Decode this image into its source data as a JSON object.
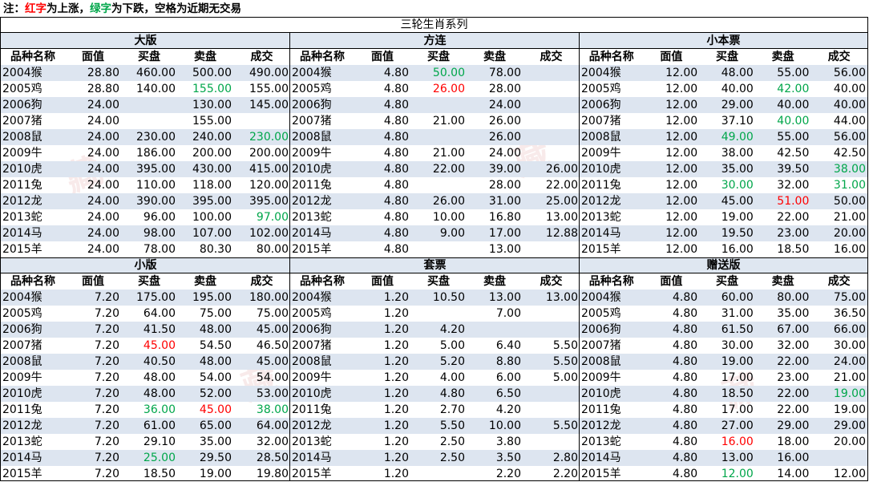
{
  "note": {
    "prefix": "注：",
    "red_word": "红字",
    "mid1": "为上涨，",
    "green_word": "绿字",
    "mid2": "为下跌，空格为近期无交易"
  },
  "colors": {
    "up": "#ff0000",
    "down": "#00a64a",
    "row_alt": "#dde5f0",
    "title_bg": "#dfe7f1"
  },
  "main_title": "三轮生肖系列",
  "headers": [
    "品种名称",
    "面值",
    "买盘",
    "卖盘",
    "成交"
  ],
  "watermark_chars": [
    "藏",
    "藏",
    "藏",
    "藏"
  ],
  "panels": [
    {
      "title": "大版",
      "rows": [
        {
          "name": "2004猴",
          "face": "28.80",
          "buy": "460.00",
          "sell": "500.00",
          "deal": "490.00",
          "sell_c": "",
          "buy_c": "",
          "deal_c": ""
        },
        {
          "name": "2005鸡",
          "face": "28.80",
          "buy": "140.00",
          "sell": "155.00",
          "deal": "155.00",
          "sell_c": "down"
        },
        {
          "name": "2006狗",
          "face": "24.00",
          "buy": "",
          "sell": "130.00",
          "deal": "145.00"
        },
        {
          "name": "2007猪",
          "face": "24.00",
          "buy": "",
          "sell": "155.00",
          "deal": ""
        },
        {
          "name": "2008鼠",
          "face": "24.00",
          "buy": "230.00",
          "sell": "240.00",
          "deal": "230.00",
          "deal_c": "down"
        },
        {
          "name": "2009牛",
          "face": "24.00",
          "buy": "186.00",
          "sell": "200.00",
          "deal": "200.00"
        },
        {
          "name": "2010虎",
          "face": "24.00",
          "buy": "395.00",
          "sell": "430.00",
          "deal": "415.00"
        },
        {
          "name": "2011兔",
          "face": "24.00",
          "buy": "110.00",
          "sell": "118.00",
          "deal": "120.00"
        },
        {
          "name": "2012龙",
          "face": "24.00",
          "buy": "390.00",
          "sell": "395.00",
          "deal": "395.00"
        },
        {
          "name": "2013蛇",
          "face": "24.00",
          "buy": "96.00",
          "sell": "100.00",
          "deal": "97.00",
          "deal_c": "down"
        },
        {
          "name": "2014马",
          "face": "24.00",
          "buy": "98.00",
          "sell": "107.00",
          "deal": "102.00"
        },
        {
          "name": "2015羊",
          "face": "24.00",
          "buy": "78.00",
          "sell": "80.30",
          "deal": "80.00"
        }
      ]
    },
    {
      "title": "方连",
      "rows": [
        {
          "name": "2004猴",
          "face": "4.80",
          "buy": "50.00",
          "sell": "78.00",
          "deal": "",
          "buy_c": "down"
        },
        {
          "name": "2005鸡",
          "face": "4.80",
          "buy": "26.00",
          "sell": "28.00",
          "deal": "",
          "buy_c": "up"
        },
        {
          "name": "2006狗",
          "face": "4.80",
          "buy": "",
          "sell": "24.00",
          "deal": ""
        },
        {
          "name": "2007猪",
          "face": "4.80",
          "buy": "21.00",
          "sell": "26.00",
          "deal": ""
        },
        {
          "name": "2008鼠",
          "face": "4.80",
          "buy": "",
          "sell": "26.00",
          "deal": ""
        },
        {
          "name": "2009牛",
          "face": "4.80",
          "buy": "21.00",
          "sell": "24.00",
          "deal": ""
        },
        {
          "name": "2010虎",
          "face": "4.80",
          "buy": "22.00",
          "sell": "39.00",
          "deal": "26.00"
        },
        {
          "name": "2011兔",
          "face": "4.80",
          "buy": "",
          "sell": "28.00",
          "deal": "22.00"
        },
        {
          "name": "2012龙",
          "face": "4.80",
          "buy": "26.00",
          "sell": "31.00",
          "deal": "25.00"
        },
        {
          "name": "2013蛇",
          "face": "4.80",
          "buy": "10.00",
          "sell": "16.80",
          "deal": "13.00"
        },
        {
          "name": "2014马",
          "face": "4.80",
          "buy": "9.00",
          "sell": "17.00",
          "deal": "12.88"
        },
        {
          "name": "2015羊",
          "face": "4.80",
          "buy": "",
          "sell": "13.00",
          "deal": ""
        }
      ]
    },
    {
      "title": "小本票",
      "rows": [
        {
          "name": "2004猴",
          "face": "12.00",
          "buy": "48.00",
          "sell": "55.00",
          "deal": "56.00"
        },
        {
          "name": "2005鸡",
          "face": "12.00",
          "buy": "40.00",
          "sell": "42.00",
          "deal": "40.00",
          "sell_c": "down"
        },
        {
          "name": "2006狗",
          "face": "12.00",
          "buy": "29.00",
          "sell": "40.00",
          "deal": "40.00"
        },
        {
          "name": "2007猪",
          "face": "12.00",
          "buy": "37.10",
          "sell": "40.00",
          "deal": "44.00",
          "sell_c": "down"
        },
        {
          "name": "2008鼠",
          "face": "12.00",
          "buy": "49.00",
          "sell": "55.00",
          "deal": "56.00",
          "buy_c": "down"
        },
        {
          "name": "2009牛",
          "face": "12.00",
          "buy": "38.00",
          "sell": "42.50",
          "deal": "42.50"
        },
        {
          "name": "2010虎",
          "face": "12.00",
          "buy": "35.00",
          "sell": "39.50",
          "deal": "38.00",
          "deal_c": "down"
        },
        {
          "name": "2011兔",
          "face": "12.00",
          "buy": "30.00",
          "sell": "32.00",
          "deal": "31.00",
          "buy_c": "down",
          "deal_c": "down"
        },
        {
          "name": "2012龙",
          "face": "12.00",
          "buy": "45.00",
          "sell": "51.00",
          "deal": "50.00",
          "sell_c": "up"
        },
        {
          "name": "2013蛇",
          "face": "12.00",
          "buy": "19.00",
          "sell": "22.00",
          "deal": "21.00"
        },
        {
          "name": "2014马",
          "face": "12.00",
          "buy": "19.50",
          "sell": "23.00",
          "deal": "20.00"
        },
        {
          "name": "2015羊",
          "face": "12.00",
          "buy": "16.00",
          "sell": "18.50",
          "deal": "16.00"
        }
      ]
    },
    {
      "title": "小版",
      "rows": [
        {
          "name": "2004猴",
          "face": "7.20",
          "buy": "175.00",
          "sell": "195.00",
          "deal": "180.00"
        },
        {
          "name": "2005鸡",
          "face": "7.20",
          "buy": "64.00",
          "sell": "75.00",
          "deal": "75.00"
        },
        {
          "name": "2006狗",
          "face": "7.20",
          "buy": "41.50",
          "sell": "48.00",
          "deal": "45.00"
        },
        {
          "name": "2007猪",
          "face": "7.20",
          "buy": "45.00",
          "sell": "54.50",
          "deal": "46.50",
          "buy_c": "up"
        },
        {
          "name": "2008鼠",
          "face": "7.20",
          "buy": "40.50",
          "sell": "48.00",
          "deal": "45.00"
        },
        {
          "name": "2009牛",
          "face": "7.20",
          "buy": "48.00",
          "sell": "54.00",
          "deal": "54.00"
        },
        {
          "name": "2010虎",
          "face": "7.20",
          "buy": "48.00",
          "sell": "52.00",
          "deal": "53.00"
        },
        {
          "name": "2011兔",
          "face": "7.20",
          "buy": "36.00",
          "sell": "45.00",
          "deal": "38.00",
          "buy_c": "down",
          "sell_c": "up",
          "deal_c": "down"
        },
        {
          "name": "2012龙",
          "face": "7.20",
          "buy": "61.00",
          "sell": "65.00",
          "deal": "64.00"
        },
        {
          "name": "2013蛇",
          "face": "7.20",
          "buy": "29.10",
          "sell": "35.00",
          "deal": "32.00"
        },
        {
          "name": "2014马",
          "face": "7.20",
          "buy": "25.00",
          "sell": "29.50",
          "deal": "28.50",
          "buy_c": "down"
        },
        {
          "name": "2015羊",
          "face": "7.20",
          "buy": "18.50",
          "sell": "19.00",
          "deal": "19.80"
        }
      ]
    },
    {
      "title": "套票",
      "rows": [
        {
          "name": "2004猴",
          "face": "1.20",
          "buy": "10.50",
          "sell": "13.00",
          "deal": "13.00"
        },
        {
          "name": "2005鸡",
          "face": "1.20",
          "buy": "",
          "sell": "7.00",
          "deal": ""
        },
        {
          "name": "2006狗",
          "face": "1.20",
          "buy": "4.20",
          "sell": "",
          "deal": ""
        },
        {
          "name": "2007猪",
          "face": "1.20",
          "buy": "5.00",
          "sell": "6.40",
          "deal": "5.50"
        },
        {
          "name": "2008鼠",
          "face": "1.20",
          "buy": "5.20",
          "sell": "8.80",
          "deal": "5.50"
        },
        {
          "name": "2009牛",
          "face": "1.20",
          "buy": "4.00",
          "sell": "6.00",
          "deal": "5.00"
        },
        {
          "name": "2010虎",
          "face": "1.20",
          "buy": "4.80",
          "sell": "6.50",
          "deal": ""
        },
        {
          "name": "2011兔",
          "face": "1.20",
          "buy": "2.70",
          "sell": "4.20",
          "deal": ""
        },
        {
          "name": "2012龙",
          "face": "1.20",
          "buy": "5.50",
          "sell": "10.00",
          "deal": "5.50"
        },
        {
          "name": "2013蛇",
          "face": "1.20",
          "buy": "2.50",
          "sell": "3.80",
          "deal": ""
        },
        {
          "name": "2014马",
          "face": "1.20",
          "buy": "2.50",
          "sell": "3.50",
          "deal": "2.80"
        },
        {
          "name": "2015羊",
          "face": "1.20",
          "buy": "",
          "sell": "2.20",
          "deal": "2.20"
        }
      ]
    },
    {
      "title": "赠送版",
      "rows": [
        {
          "name": "2004猴",
          "face": "4.80",
          "buy": "60.00",
          "sell": "80.00",
          "deal": "75.00"
        },
        {
          "name": "2005鸡",
          "face": "4.80",
          "buy": "31.00",
          "sell": "35.00",
          "deal": "36.50"
        },
        {
          "name": "2006狗",
          "face": "4.80",
          "buy": "61.50",
          "sell": "67.00",
          "deal": "66.00"
        },
        {
          "name": "2007猪",
          "face": "4.80",
          "buy": "30.00",
          "sell": "32.00",
          "deal": "30.00"
        },
        {
          "name": "2008鼠",
          "face": "4.80",
          "buy": "19.00",
          "sell": "22.00",
          "deal": "24.00"
        },
        {
          "name": "2009牛",
          "face": "4.80",
          "buy": "17.00",
          "sell": "23.00",
          "deal": "21.00"
        },
        {
          "name": "2010虎",
          "face": "4.80",
          "buy": "18.50",
          "sell": "22.00",
          "deal": "19.00",
          "deal_c": "down"
        },
        {
          "name": "2011兔",
          "face": "4.80",
          "buy": "17.00",
          "sell": "22.00",
          "deal": "19.00"
        },
        {
          "name": "2012龙",
          "face": "4.80",
          "buy": "27.00",
          "sell": "29.00",
          "deal": "29.00"
        },
        {
          "name": "2013蛇",
          "face": "4.80",
          "buy": "16.00",
          "sell": "18.00",
          "deal": "20.00",
          "buy_c": "up"
        },
        {
          "name": "2014马",
          "face": "4.80",
          "buy": "13.00",
          "sell": "16.00",
          "deal": ""
        },
        {
          "name": "2015羊",
          "face": "4.80",
          "buy": "12.00",
          "sell": "14.00",
          "deal": "12.00",
          "buy_c": "down"
        }
      ]
    }
  ]
}
